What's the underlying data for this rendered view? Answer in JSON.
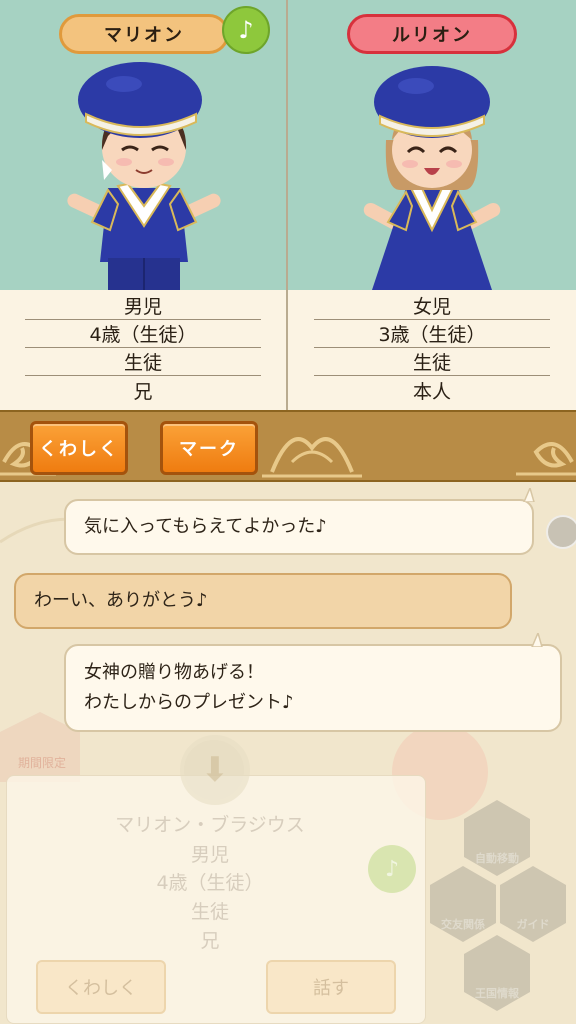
{
  "left_character": {
    "name": "マリオン",
    "info": [
      "男児",
      "4歳（生徒）",
      "生徒",
      "兄"
    ],
    "music_icon": "♪"
  },
  "right_character": {
    "name": "ルリオン",
    "info": [
      "女児",
      "3歳（生徒）",
      "生徒",
      "本人"
    ]
  },
  "actions": {
    "details_label": "くわしく",
    "mark_label": "マーク"
  },
  "chat": {
    "message_1": "気に入ってもらえてよかった♪",
    "message_2": "わーい、ありがとう♪",
    "message_3_line1": "女神の贈り物あげる！",
    "message_3_line2": "わたしからのプレゼント♪"
  },
  "background_card": {
    "limited_label": "期間限定",
    "name": "マリオン・ブラジウス",
    "info": [
      "男児",
      "4歳（生徒）",
      "生徒",
      "兄"
    ],
    "details_label": "くわしく",
    "talk_label": "話す",
    "music_icon": "♪",
    "menu": [
      "自動移動",
      "交友関係",
      "ガイド",
      "王国情報"
    ]
  },
  "colors": {
    "stage_bg": "#a6d2c2",
    "uniform_blue": "#2c3aa6",
    "orange_button": "#ef7c10",
    "name_tag_orange": "#f3c37e",
    "name_tag_red": "#f37d86",
    "music_green": "#8ec83c"
  }
}
